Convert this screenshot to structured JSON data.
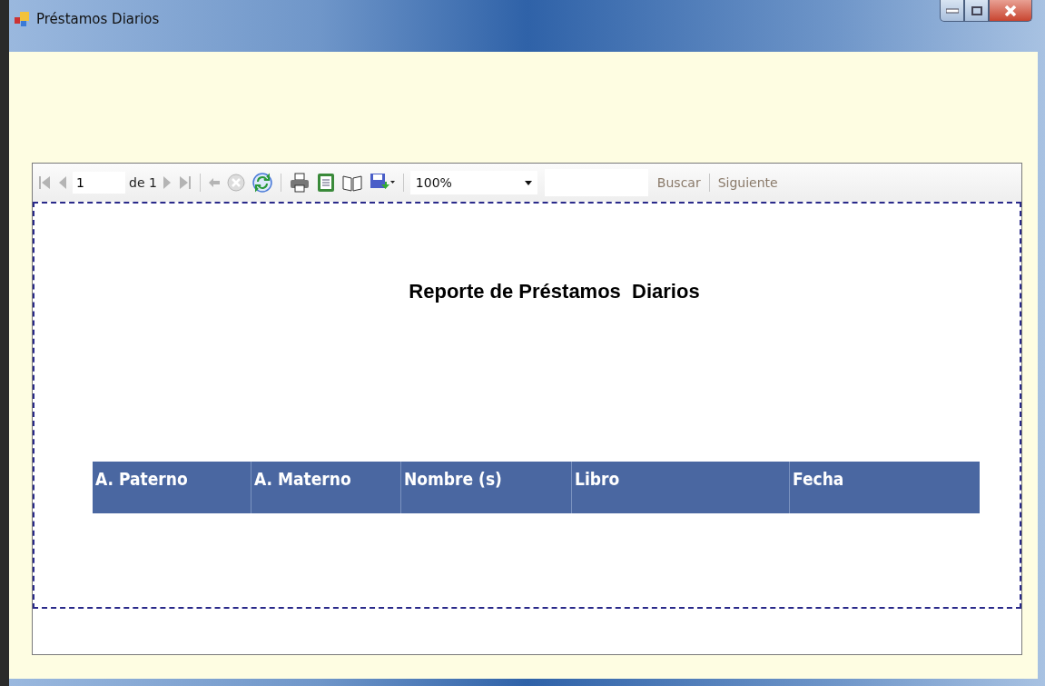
{
  "window": {
    "title": "Préstamos Diarios"
  },
  "toolbar": {
    "items": [
      {
        "kind": "first",
        "disabled": true
      },
      {
        "kind": "prev",
        "disabled": true
      },
      {
        "kind": "page",
        "value": "1"
      },
      {
        "kind": "label",
        "text": "de 1"
      },
      {
        "kind": "next",
        "disabled": true
      },
      {
        "kind": "last",
        "disabled": true
      },
      {
        "kind": "sep"
      },
      {
        "kind": "back",
        "disabled": true
      },
      {
        "kind": "stop",
        "disabled": true
      },
      {
        "kind": "refresh",
        "disabled": false
      },
      {
        "kind": "sep"
      },
      {
        "kind": "print",
        "disabled": false
      },
      {
        "kind": "layout",
        "disabled": false
      },
      {
        "kind": "setup",
        "disabled": false
      },
      {
        "kind": "export",
        "disabled": false
      },
      {
        "kind": "sep"
      },
      {
        "kind": "zoom",
        "value": "100%"
      },
      {
        "kind": "search"
      },
      {
        "kind": "find",
        "text": "Buscar",
        "disabled": true
      },
      {
        "kind": "sep"
      },
      {
        "kind": "find",
        "text": "Siguiente",
        "disabled": true
      }
    ]
  },
  "report": {
    "title": "Reporte de Préstamos  Diarios",
    "columns": [
      "A. Paterno",
      "A. Materno",
      "Nombre (s)",
      "Libro",
      "Fecha"
    ]
  }
}
